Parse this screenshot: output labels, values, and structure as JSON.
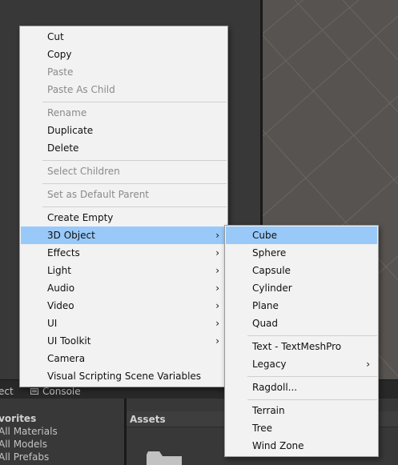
{
  "context_menu": {
    "items": [
      {
        "label": "Cut",
        "enabled": true
      },
      {
        "label": "Copy",
        "enabled": true
      },
      {
        "label": "Paste",
        "enabled": false
      },
      {
        "label": "Paste As Child",
        "enabled": false
      },
      {
        "label": "Rename",
        "enabled": false
      },
      {
        "label": "Duplicate",
        "enabled": true
      },
      {
        "label": "Delete",
        "enabled": true
      },
      {
        "label": "Select Children",
        "enabled": false
      },
      {
        "label": "Set as Default Parent",
        "enabled": false
      },
      {
        "label": "Create Empty",
        "enabled": true
      },
      {
        "label": "3D Object",
        "enabled": true,
        "submenu": true,
        "highlighted": true
      },
      {
        "label": "Effects",
        "enabled": true,
        "submenu": true
      },
      {
        "label": "Light",
        "enabled": true,
        "submenu": true
      },
      {
        "label": "Audio",
        "enabled": true,
        "submenu": true
      },
      {
        "label": "Video",
        "enabled": true,
        "submenu": true
      },
      {
        "label": "UI",
        "enabled": true,
        "submenu": true
      },
      {
        "label": "UI Toolkit",
        "enabled": true,
        "submenu": true
      },
      {
        "label": "Camera",
        "enabled": true
      },
      {
        "label": "Visual Scripting Scene Variables",
        "enabled": true
      }
    ]
  },
  "submenu_3d_object": {
    "items": [
      {
        "label": "Cube",
        "highlighted": true
      },
      {
        "label": "Sphere"
      },
      {
        "label": "Capsule"
      },
      {
        "label": "Cylinder"
      },
      {
        "label": "Plane"
      },
      {
        "label": "Quad"
      },
      {
        "label": "Text - TextMeshPro"
      },
      {
        "label": "Legacy",
        "submenu": true
      },
      {
        "label": "Ragdoll..."
      },
      {
        "label": "Terrain"
      },
      {
        "label": "Tree"
      },
      {
        "label": "Wind Zone"
      }
    ]
  },
  "bottom_tabs": {
    "project": "ect",
    "console": "Console"
  },
  "project_panel": {
    "favorites_header": "avorites",
    "favorites": [
      "All Materials",
      "All Models",
      "All Prefabs"
    ],
    "assets_header": "Assets"
  },
  "glyphs": {
    "submenu_arrow": "›"
  },
  "colors": {
    "menu_bg": "#f2f2f2",
    "highlight": "#99c9f9",
    "disabled_text": "#8a8a8a",
    "editor_bg": "#383838",
    "scene_bg": "#575350"
  }
}
